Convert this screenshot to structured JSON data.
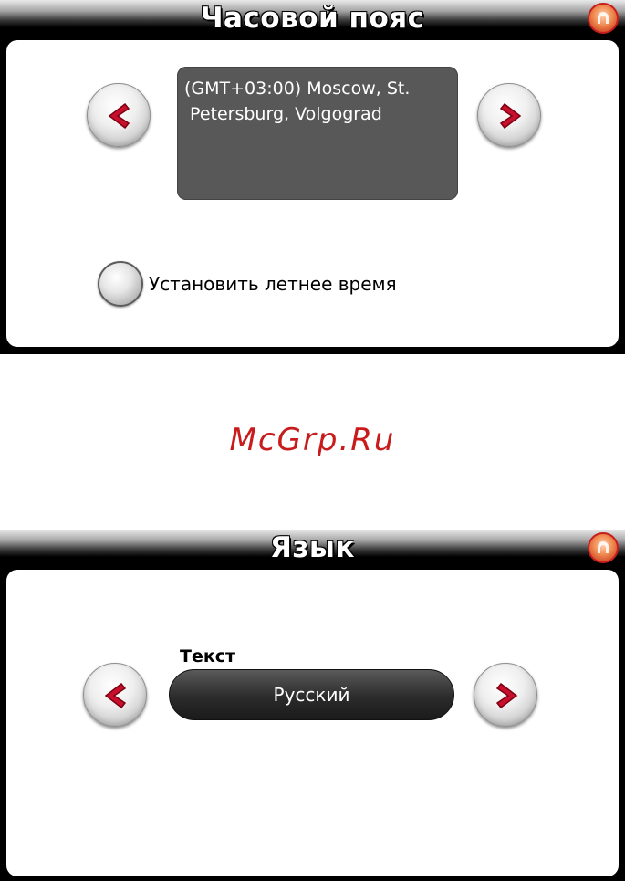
{
  "timezone_screen": {
    "title": "Часовой пояс",
    "timezone_line1": "(GMT+03:00) Moscow, St.",
    "timezone_line2": " Petersburg, Volgograd",
    "dst_label": "Установить летнее время",
    "prev_icon": "chevron-left-icon",
    "next_icon": "chevron-right-icon",
    "home_icon": "home-icon"
  },
  "watermark": "McGrp.Ru",
  "language_screen": {
    "title": "Язык",
    "text_label": "Текст",
    "language_value": "Русский",
    "prev_icon": "chevron-left-icon",
    "next_icon": "chevron-right-icon",
    "home_icon": "home-icon"
  },
  "colors": {
    "arrow_red": "#c8102e",
    "home_orange": "#e8743c",
    "watermark_red": "#c81b1b"
  }
}
